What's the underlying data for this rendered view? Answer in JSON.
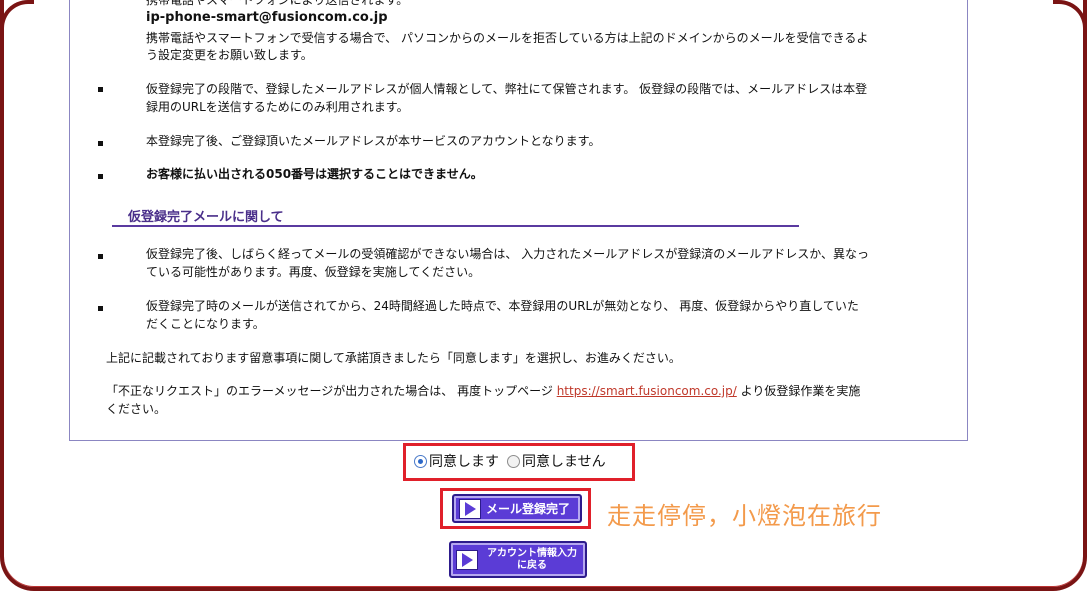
{
  "header_partial": "携帯電話やスマートフォンにより送信されます。",
  "email": "ip-phone-smart@fusioncom.co.jp",
  "email_note_1": "携帯電話やスマートフォンで受信する場合で、 パソコンからのメールを拒否している方は上記のドメインからのメールを受信できるよ",
  "email_note_2": "う設定変更をお願い致します。",
  "bullets": [
    {
      "line1": "仮登録完了の段階で、登録したメールアドレスが個人情報として、弊社にて保管されます。 仮登録の段階では、メールアドレスは本登",
      "line2": "録用のURLを送信するためにのみ利用されます。"
    },
    {
      "line1": "本登録完了後、ご登録頂いたメールアドレスが本サービスのアカウントとなります。"
    },
    {
      "line1": "お客様に払い出される050番号は選択することはできません。"
    }
  ],
  "section_heading": "仮登録完了メールに関して",
  "section_bullets": [
    {
      "line1": "仮登録完了後、しばらく経ってメールの受領確認ができない場合は、 入力されたメールアドレスが登録済のメールアドレスか、異なっ",
      "line2": "ている可能性があります。再度、仮登録を実施してください。"
    },
    {
      "line1": "仮登録完了時のメールが送信されてから、24時間経過した時点で、本登録用のURLが無効となり、 再度、仮登録からやり直していた",
      "line2": "だくことになります。"
    }
  ],
  "consent_text": "上記に記載されております留意事項に関して承諾頂きましたら「同意します」を選択し、お進みください。",
  "error_text_1": "「不正なリクエスト」のエラーメッセージが出力された場合は、 再度トップページ",
  "error_link": "https://smart.fusioncom.co.jp/",
  "error_text_2": "より仮登録作業を実施",
  "error_text_3": "ください。",
  "agree": {
    "yes_label": "同意します",
    "no_label": "同意しません",
    "selected": "yes"
  },
  "buttons": {
    "submit_label": "メール登録完了",
    "back_line1": "アカウント情報入力",
    "back_line2": "に戻る"
  },
  "watermark": "走走停停，小燈泡在旅行",
  "colors": {
    "accent": "#5b3cd6",
    "highlight": "#e0202a",
    "frame": "#7a1414",
    "link": "#c0392b",
    "watermark": "#f39a4b"
  }
}
